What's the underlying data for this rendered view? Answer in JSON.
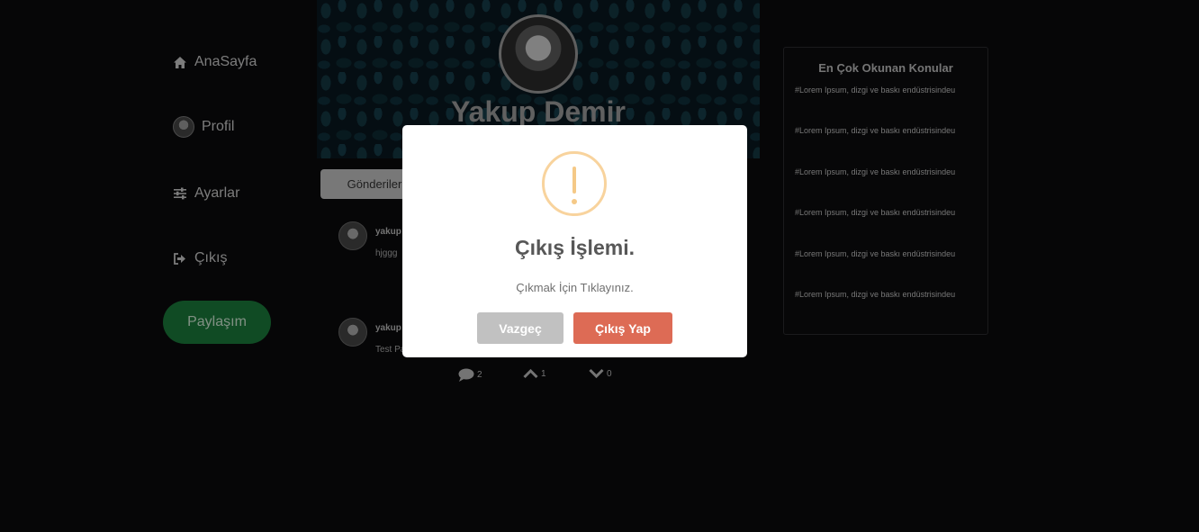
{
  "sidebar": {
    "items": [
      {
        "label": "AnaSayfa",
        "icon": "home-icon"
      },
      {
        "label": "Profil",
        "icon": "avatar"
      },
      {
        "label": "Ayarlar",
        "icon": "sliders-icon"
      },
      {
        "label": "Çıkış",
        "icon": "sign-out-icon"
      }
    ],
    "share_label": "Paylaşım"
  },
  "profile": {
    "name": "Yakup Demir"
  },
  "tabs": {
    "posts_label": "Gönderiler"
  },
  "posts": [
    {
      "user": "yakup",
      "text": "hjggg"
    },
    {
      "user": "yakup",
      "text": "Test Pa"
    }
  ],
  "post_stats": {
    "comments": "2",
    "upvotes": "1",
    "downvotes": "0"
  },
  "widget": {
    "title": "En Çok Okunan Konular",
    "items": [
      "#Lorem Ipsum, dizgi ve baskı endüstrisindeu",
      "#Lorem Ipsum, dizgi ve baskı endüstrisindeu",
      "#Lorem Ipsum, dizgi ve baskı endüstrisindeu",
      "#Lorem Ipsum, dizgi ve baskı endüstrisindeu",
      "#Lorem Ipsum, dizgi ve baskı endüstrisindeu",
      "#Lorem Ipsum, dizgi ve baskı endüstrisindeu"
    ]
  },
  "modal": {
    "icon": "warning-icon",
    "title": "Çıkış İşlemi.",
    "text": "Çıkmak İçin Tıklayınız.",
    "cancel_label": "Vazgeç",
    "confirm_label": "Çıkış Yap"
  },
  "colors": {
    "background": "#0a0a0c",
    "share_button": "#1b7a3b",
    "confirm_button": "#dd6b55",
    "cancel_button": "#c1c1c1",
    "warning": "#f8d39d"
  }
}
